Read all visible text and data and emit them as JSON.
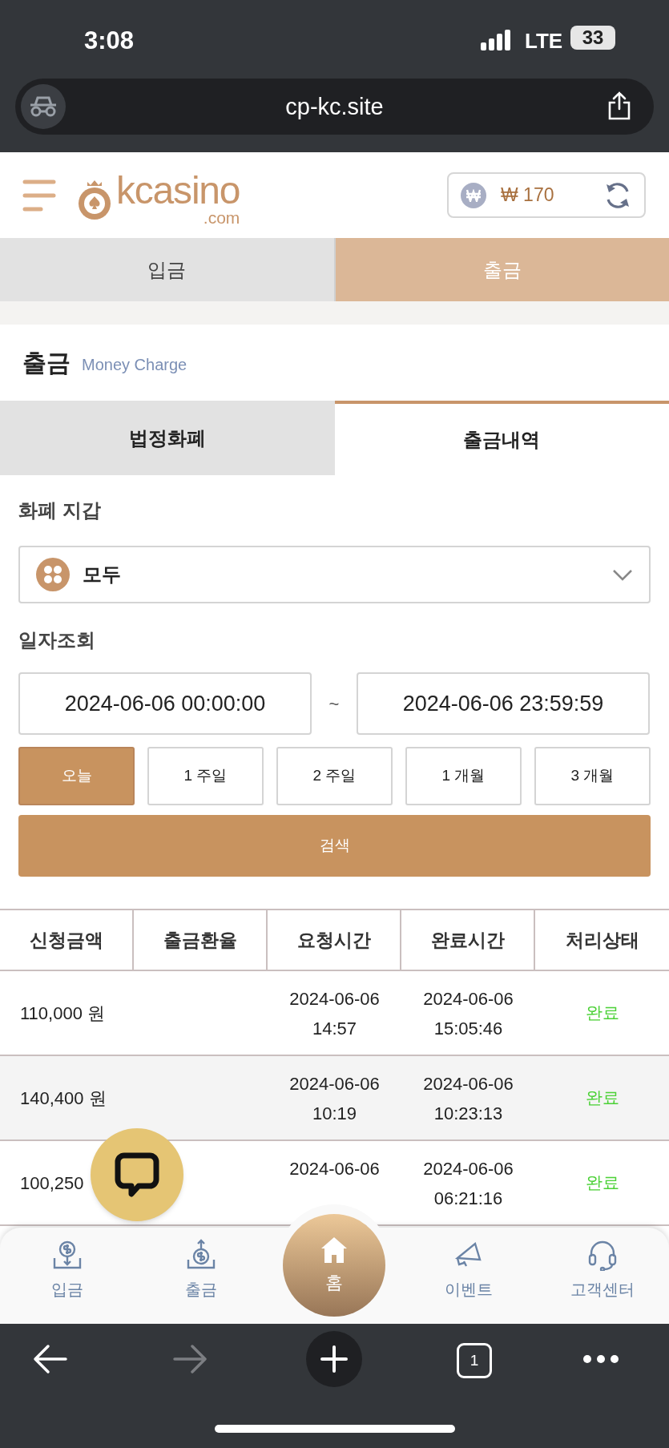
{
  "status_bar": {
    "time": "3:08",
    "network": "LTE",
    "battery": "33"
  },
  "browser": {
    "url": "cp-kc.site",
    "tab_count": "1"
  },
  "header": {
    "logo": "kcasino",
    "logo_suffix": ".com",
    "balance": "₩ 170"
  },
  "main_tabs": [
    {
      "label": "입금",
      "selected": false
    },
    {
      "label": "출금",
      "selected": true
    }
  ],
  "page_title": {
    "title": "출금",
    "subtitle": "Money Charge"
  },
  "sub_tabs": [
    {
      "label": "법정화폐",
      "selected": false
    },
    {
      "label": "출금내역",
      "selected": true
    }
  ],
  "wallet": {
    "label": "화폐 지갑",
    "value": "모두"
  },
  "date_query": {
    "label": "일자조회",
    "from": "2024-06-06 00:00:00",
    "separator": "~",
    "to": "2024-06-06 23:59:59"
  },
  "periods": [
    {
      "label": "오늘",
      "selected": true
    },
    {
      "label": "1 주일",
      "selected": false
    },
    {
      "label": "2 주일",
      "selected": false
    },
    {
      "label": "1 개월",
      "selected": false
    },
    {
      "label": "3 개월",
      "selected": false
    }
  ],
  "search_button": "검색",
  "table": {
    "columns": [
      "신청금액",
      "출금환율",
      "요청시간",
      "완료시간",
      "처리상태"
    ],
    "rows": [
      {
        "amount": "110,000 원",
        "requested": [
          "2024-06-06",
          "14:57"
        ],
        "completed": [
          "2024-06-06",
          "15:05:46"
        ],
        "status": "완료"
      },
      {
        "amount": "140,400 원",
        "requested": [
          "2024-06-06",
          "10:19"
        ],
        "completed": [
          "2024-06-06",
          "10:23:13"
        ],
        "status": "완료"
      },
      {
        "amount": "100,250",
        "requested": [
          "2024-06-06"
        ],
        "completed": [
          "2024-06-06",
          "06:21:16"
        ],
        "status": "완료"
      }
    ]
  },
  "bottom_nav": [
    {
      "label": "입금",
      "kind": "deposit"
    },
    {
      "label": "출금",
      "kind": "withdraw"
    },
    {
      "label": "홈",
      "kind": "home"
    },
    {
      "label": "이벤트",
      "kind": "event"
    },
    {
      "label": "고객센터",
      "kind": "support"
    }
  ]
}
